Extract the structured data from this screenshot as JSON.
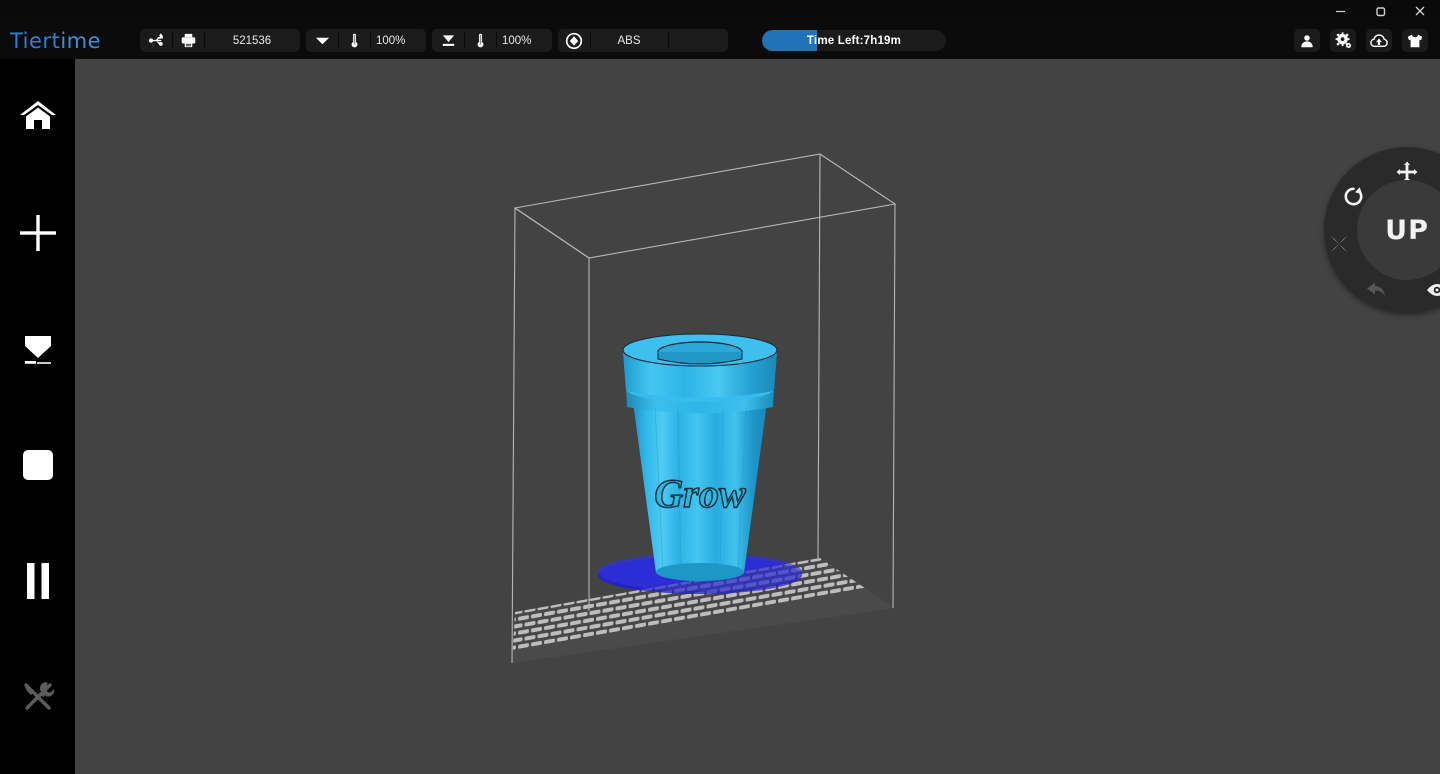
{
  "window": {
    "controls": [
      {
        "name": "minimize",
        "label": "─"
      },
      {
        "name": "maximize",
        "label": "❐"
      },
      {
        "name": "close",
        "label": "✕"
      }
    ]
  },
  "brand": {
    "name_part1": "Tiert",
    "name_part2": "ime",
    "color": "#3d8fd8"
  },
  "toolbar": {
    "connection_icon": "usb-icon",
    "printer_icon": "printer-icon",
    "job_id": "521536",
    "nozzle": {
      "icon": "nozzle-icon",
      "thermometer_icon": "thermometer-icon",
      "value": "100%"
    },
    "platform": {
      "icon": "platform-icon",
      "thermometer_icon": "thermometer-icon",
      "value": "100%"
    },
    "material": {
      "icon": "material-spool-icon",
      "value": "ABS"
    },
    "blank_slot": "",
    "progress": {
      "label": "Time Left:7h19m",
      "percent": 30,
      "fill_color": "#2073b6"
    },
    "right_icons": [
      {
        "name": "user-account-icon",
        "glyph": "user"
      },
      {
        "name": "settings-gear-icon",
        "glyph": "gear"
      },
      {
        "name": "cloud-upload-icon",
        "glyph": "cloud"
      },
      {
        "name": "material-shirt-icon",
        "glyph": "shirt"
      }
    ]
  },
  "sidebar": {
    "items": [
      {
        "name": "home",
        "icon": "home-icon",
        "enabled": true
      },
      {
        "name": "add-model",
        "icon": "plus-icon",
        "enabled": true
      },
      {
        "name": "extrude",
        "icon": "extrude-icon",
        "enabled": true
      },
      {
        "name": "stop-print",
        "icon": "stop-square-icon",
        "enabled": true
      },
      {
        "name": "pause-print",
        "icon": "pause-icon",
        "enabled": true
      },
      {
        "name": "maintenance",
        "icon": "tools-wrench-icon",
        "enabled": false
      }
    ]
  },
  "viewport": {
    "background": "#434343",
    "build_volume": {
      "wireframe_color": "#b4b4b4"
    },
    "build_plate": {
      "grid_color": "#b0b0b0",
      "shadow_color": "#2e2e2e"
    },
    "model": {
      "name": "flower-pot",
      "engraved_text": "Grow",
      "body_color": "#29b6e8",
      "highlight_color": "#5fd0f4",
      "shade_color": "#1c9ccb",
      "raft_color": "#2222cc"
    }
  },
  "nav_wheel": {
    "center_label": "UP",
    "buttons": [
      {
        "name": "move-tool",
        "icon": "move-arrows-icon"
      },
      {
        "name": "scale-tool",
        "icon": "scale-resize-icon"
      },
      {
        "name": "rotate-tool",
        "icon": "rotate-icon"
      },
      {
        "name": "menu",
        "icon": "hamburger-menu-icon"
      },
      {
        "name": "mirror-tool",
        "icon": "mirror-x-icon"
      },
      {
        "name": "undo",
        "icon": "undo-arrow-icon"
      },
      {
        "name": "view-visibility",
        "icon": "eye-icon"
      }
    ]
  }
}
